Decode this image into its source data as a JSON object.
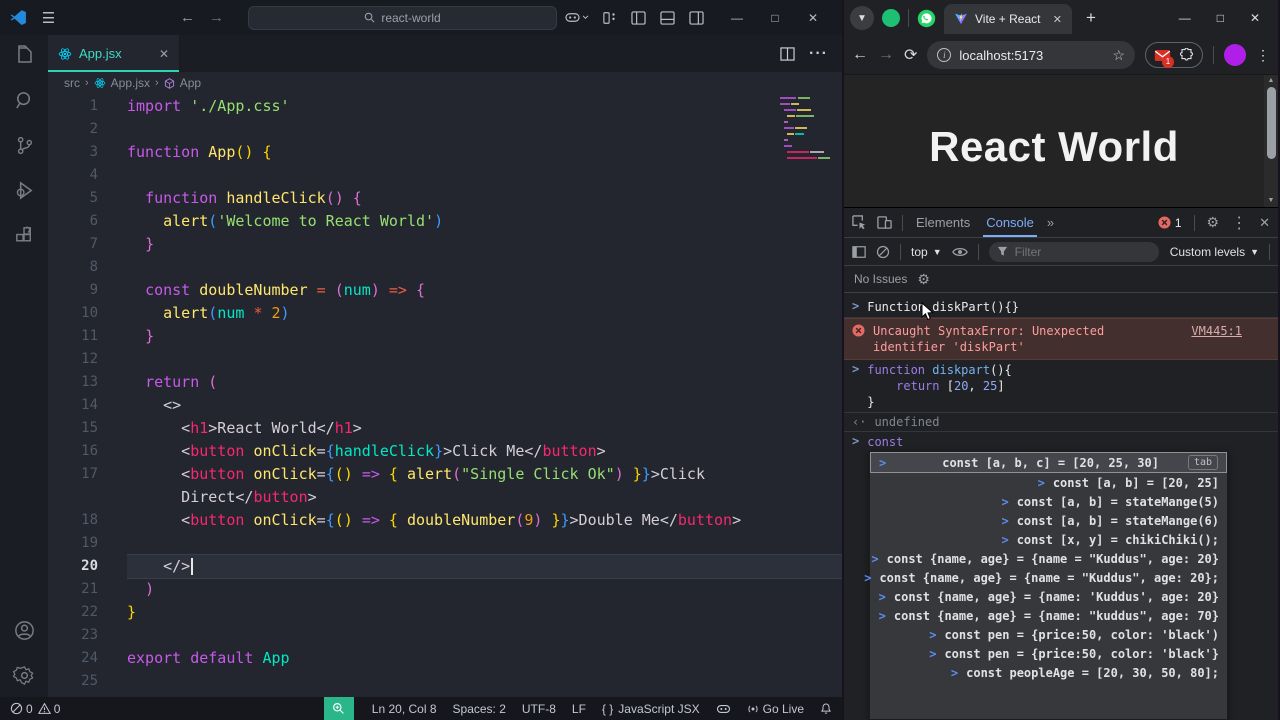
{
  "vscode": {
    "title_search": "react-world",
    "tab": {
      "label": "App.jsx",
      "close": "✕"
    },
    "breadcrumb": {
      "items": [
        "src",
        "App.jsx",
        "App"
      ]
    },
    "status": {
      "errors": "0",
      "warnings": "0",
      "cursor_pos": "Ln 20, Col 8",
      "spaces": "Spaces: 2",
      "encoding": "UTF-8",
      "eol": "LF",
      "language": "JavaScript JSX",
      "lang_icon": "{ }",
      "golive": "Go Live"
    },
    "code": {
      "active_line": "20",
      "lines": [
        {
          "n": "1",
          "tokens": [
            [
              "kw",
              "import"
            ],
            [
              "w",
              " "
            ],
            [
              "str",
              "'./App.css'"
            ]
          ]
        },
        {
          "n": "2",
          "tokens": []
        },
        {
          "n": "3",
          "tokens": [
            [
              "kw",
              "function"
            ],
            [
              "w",
              " "
            ],
            [
              "fn",
              "App"
            ],
            [
              "g",
              "()"
            ],
            [
              "w",
              " "
            ],
            [
              "g",
              "{"
            ]
          ]
        },
        {
          "n": "4",
          "tokens": []
        },
        {
          "n": "5",
          "tokens": [
            [
              "w",
              "  "
            ],
            [
              "kw",
              "function"
            ],
            [
              "w",
              " "
            ],
            [
              "fn",
              "handleClick"
            ],
            [
              "o",
              "()"
            ],
            [
              "w",
              " "
            ],
            [
              "o",
              "{"
            ]
          ]
        },
        {
          "n": "6",
          "tokens": [
            [
              "w",
              "    "
            ],
            [
              "fn",
              "alert"
            ],
            [
              "b",
              "("
            ],
            [
              "str",
              "'Welcome to React World'"
            ],
            [
              "b",
              ")"
            ]
          ]
        },
        {
          "n": "7",
          "tokens": [
            [
              "w",
              "  "
            ],
            [
              "o",
              "}"
            ]
          ]
        },
        {
          "n": "8",
          "tokens": []
        },
        {
          "n": "9",
          "tokens": [
            [
              "w",
              "  "
            ],
            [
              "kw",
              "const"
            ],
            [
              "w",
              " "
            ],
            [
              "fn",
              "doubleNumber"
            ],
            [
              "w",
              " "
            ],
            [
              "op",
              "="
            ],
            [
              "w",
              " "
            ],
            [
              "o",
              "("
            ],
            [
              "cy",
              "num"
            ],
            [
              "o",
              ")"
            ],
            [
              "w",
              " "
            ],
            [
              "op",
              "=>"
            ],
            [
              "w",
              " "
            ],
            [
              "o",
              "{"
            ]
          ]
        },
        {
          "n": "10",
          "tokens": [
            [
              "w",
              "    "
            ],
            [
              "fn",
              "alert"
            ],
            [
              "b",
              "("
            ],
            [
              "cy",
              "num"
            ],
            [
              "w",
              " "
            ],
            [
              "op",
              "*"
            ],
            [
              "w",
              " "
            ],
            [
              "num",
              "2"
            ],
            [
              "b",
              ")"
            ]
          ]
        },
        {
          "n": "11",
          "tokens": [
            [
              "w",
              "  "
            ],
            [
              "o",
              "}"
            ]
          ]
        },
        {
          "n": "12",
          "tokens": []
        },
        {
          "n": "13",
          "tokens": [
            [
              "w",
              "  "
            ],
            [
              "kw",
              "return"
            ],
            [
              "w",
              " "
            ],
            [
              "o",
              "("
            ]
          ]
        },
        {
          "n": "14",
          "tokens": [
            [
              "w",
              "    <>"
            ]
          ]
        },
        {
          "n": "15",
          "tokens": [
            [
              "w",
              "      <"
            ],
            [
              "tag",
              "h1"
            ],
            [
              "w",
              ">React World</"
            ],
            [
              "tag",
              "h1"
            ],
            [
              "w",
              ">"
            ]
          ]
        },
        {
          "n": "16",
          "tokens": [
            [
              "w",
              "      <"
            ],
            [
              "tag",
              "button"
            ],
            [
              "w",
              " "
            ],
            [
              "fn",
              "onClick"
            ],
            [
              "w",
              "="
            ],
            [
              "b",
              "{"
            ],
            [
              "cy",
              "handleClick"
            ],
            [
              "b",
              "}"
            ],
            [
              "w",
              ">Click Me</"
            ],
            [
              "tag",
              "button"
            ],
            [
              "w",
              ">"
            ]
          ]
        },
        {
          "n": "17",
          "tokens": [
            [
              "w",
              "      <"
            ],
            [
              "tag",
              "button"
            ],
            [
              "w",
              " "
            ],
            [
              "fn",
              "onClick"
            ],
            [
              "w",
              "="
            ],
            [
              "b",
              "{"
            ],
            [
              "g",
              "()"
            ],
            [
              "w",
              " "
            ],
            [
              "kw",
              "=>"
            ],
            [
              "w",
              " "
            ],
            [
              "g",
              "{"
            ],
            [
              "w",
              " "
            ],
            [
              "fn",
              "alert"
            ],
            [
              "o",
              "("
            ],
            [
              "str",
              "\"Single Click Ok\""
            ],
            [
              "o",
              ")"
            ],
            [
              "w",
              " "
            ],
            [
              "g",
              "}"
            ],
            [
              "b",
              "}"
            ],
            [
              "w",
              ">Click"
            ]
          ]
        },
        {
          "n": "",
          "tokens": [
            [
              "w",
              "      Direct</"
            ],
            [
              "tag",
              "button"
            ],
            [
              "w",
              ">"
            ]
          ]
        },
        {
          "n": "18",
          "tokens": [
            [
              "w",
              "      <"
            ],
            [
              "tag",
              "button"
            ],
            [
              "w",
              " "
            ],
            [
              "fn",
              "onClick"
            ],
            [
              "w",
              "="
            ],
            [
              "b",
              "{"
            ],
            [
              "g",
              "()"
            ],
            [
              "w",
              " "
            ],
            [
              "kw",
              "=>"
            ],
            [
              "w",
              " "
            ],
            [
              "g",
              "{"
            ],
            [
              "w",
              " "
            ],
            [
              "fn",
              "doubleNumber"
            ],
            [
              "o",
              "("
            ],
            [
              "num",
              "9"
            ],
            [
              "o",
              ")"
            ],
            [
              "w",
              " "
            ],
            [
              "g",
              "}"
            ],
            [
              "b",
              "}"
            ],
            [
              "w",
              ">Double Me</"
            ],
            [
              "tag",
              "button"
            ],
            [
              "w",
              ">"
            ]
          ]
        },
        {
          "n": "19",
          "tokens": []
        },
        {
          "n": "20",
          "active": true,
          "caret": true,
          "tokens": [
            [
              "w",
              "    </>"
            ]
          ]
        },
        {
          "n": "21",
          "tokens": [
            [
              "w",
              "  "
            ],
            [
              "o",
              ")"
            ]
          ]
        },
        {
          "n": "22",
          "tokens": [
            [
              "g",
              "}"
            ]
          ]
        },
        {
          "n": "23",
          "tokens": []
        },
        {
          "n": "24",
          "tokens": [
            [
              "kw",
              "export"
            ],
            [
              "w",
              " "
            ],
            [
              "kw",
              "default"
            ],
            [
              "w",
              " "
            ],
            [
              "cy",
              "App"
            ]
          ]
        },
        {
          "n": "25",
          "tokens": []
        }
      ]
    }
  },
  "chrome": {
    "tab_title": "Vite + React",
    "url": "localhost:5173",
    "extension_badge": "1",
    "page_heading": "React World",
    "devtools": {
      "tab_elements": "Elements",
      "tab_console": "Console",
      "more_tabs": "»",
      "error_count": "1",
      "context": "top",
      "filter_placeholder": "Filter",
      "levels": "Custom levels",
      "issues": "No Issues",
      "console": {
        "entries": [
          {
            "kind": "input",
            "lines": [
              [
                [
                  "w",
                  "Function diskPart(){}"
                ]
              ]
            ]
          },
          {
            "kind": "error",
            "line1": "Uncaught SyntaxError: Unexpected identifier",
            "line2": "'diskPart'",
            "link": "VM445:1"
          },
          {
            "kind": "input",
            "lines": [
              [
                [
                  "kw",
                  "function"
                ],
                [
                  "w",
                  " "
                ],
                [
                  "fn",
                  "diskpart"
                ],
                [
                  "w",
                  "(){"
                ]
              ],
              [
                [
                  "w",
                  "    "
                ],
                [
                  "kw",
                  "return"
                ],
                [
                  "w",
                  " "
                ],
                [
                  "w",
                  "["
                ],
                [
                  "num",
                  "20"
                ],
                [
                  "w",
                  ", "
                ],
                [
                  "num",
                  "25"
                ],
                [
                  "w",
                  "]"
                ]
              ],
              [
                [
                  "w",
                  "}"
                ]
              ]
            ]
          },
          {
            "kind": "result",
            "text": "undefined"
          },
          {
            "kind": "input-active",
            "lines": [
              [
                [
                  "kw",
                  "const"
                ]
              ]
            ]
          }
        ],
        "autocomplete": {
          "tab_hint": "tab",
          "selected": "const [a, b, c] = [20, 25, 30]",
          "items": [
            "const [a, b] = [20, 25]",
            "const [a, b] = stateMange(5)",
            "const [a, b] = stateMange(6)",
            "const [x, y] = chikiChiki();",
            "const {name, age} = {name = \"Kuddus\", age: 20}",
            "const {name, age} = {name = \"Kuddus\", age: 20};",
            "const {name, age} = {name: 'Kuddus', age: 20}",
            "const {name, age} = {name: \"kuddus\", age: 70}",
            "const pen = {price:50, color: 'black')",
            "const pen = {price:50, color: 'black'}",
            "const peopleAge = [20, 30, 50, 80];"
          ]
        }
      }
    }
  }
}
